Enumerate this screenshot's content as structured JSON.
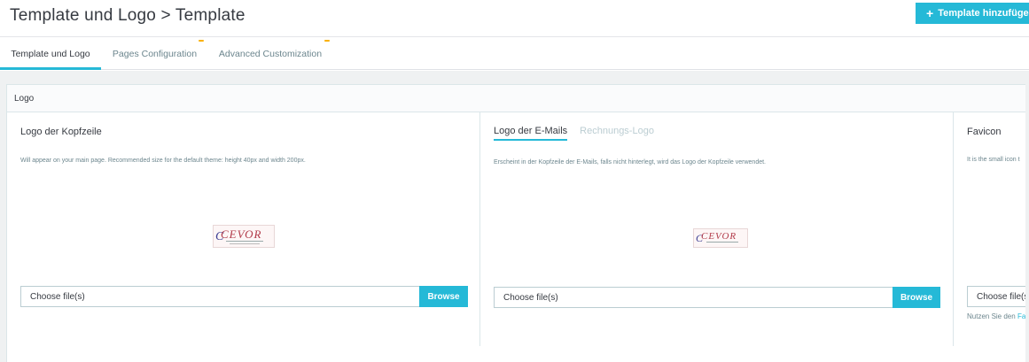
{
  "header": {
    "title": "Template und Logo > Template",
    "add_button": {
      "icon": "plus-icon",
      "label": "Template hinzufügen"
    }
  },
  "tabs": [
    {
      "label": "Template und Logo",
      "active": true
    },
    {
      "label": "Pages Configuration",
      "active": false
    },
    {
      "label": "Advanced Customization",
      "active": false
    }
  ],
  "panel": {
    "title": "Logo",
    "header_logo": {
      "title": "Logo der Kopfzeile",
      "help": "Will appear on your main page. Recommended size for the default theme: height 40px and width 200px.",
      "image_alt": "CEVOR",
      "file_placeholder": "Choose file(s)",
      "browse_label": "Browse"
    },
    "email_logo": {
      "tabs": [
        {
          "label": "Logo der E-Mails",
          "active": true
        },
        {
          "label": "Rechnungs-Logo",
          "active": false
        }
      ],
      "help": "Erscheint in der Kopfzeile der E-Mails, falls nicht hinterlegt, wird das Logo der Kopfzeile verwendet.",
      "image_alt": "CEVOR",
      "file_placeholder": "Choose file(s)",
      "browse_label": "Browse"
    },
    "favicon": {
      "title": "Favicon",
      "help": "It is the small icon t",
      "file_placeholder": "Choose file(s)",
      "hint_prefix": "Nutzen Sie den",
      "hint_link": "Fa"
    }
  },
  "colors": {
    "accent": "#25b9d7",
    "tab_dot": "#fab000",
    "background": "#eff1f2"
  }
}
